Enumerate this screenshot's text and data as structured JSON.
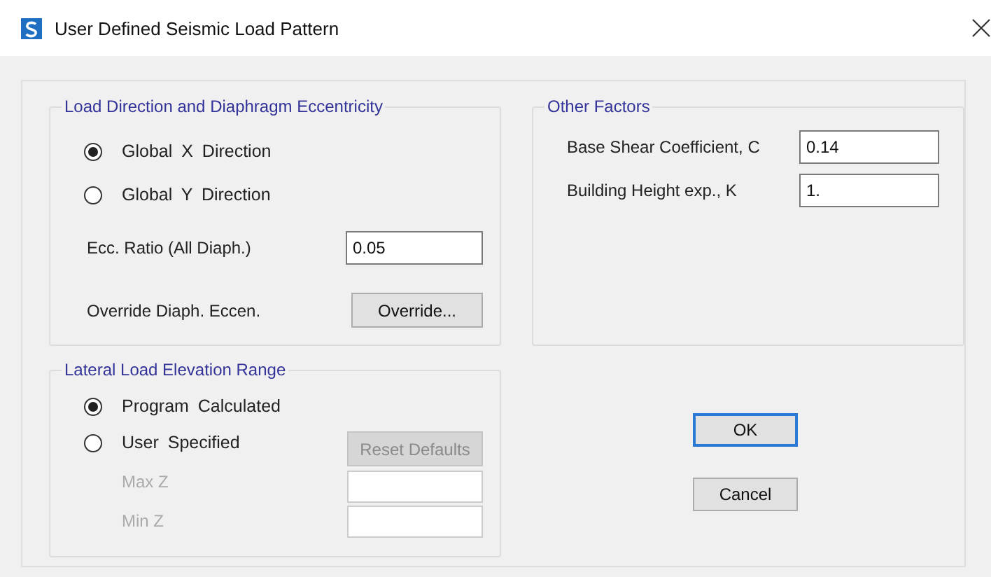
{
  "window": {
    "title": "User Defined Seismic Load Pattern"
  },
  "load_direction": {
    "title": "Load Direction and Diaphragm Eccentricity",
    "options": [
      {
        "label": "Global X Direction",
        "selected": true
      },
      {
        "label": "Global Y Direction",
        "selected": false
      }
    ],
    "ecc_ratio": {
      "label": "Ecc. Ratio (All Diaph.)",
      "value": "0.05"
    },
    "override": {
      "label": "Override Diaph. Eccen.",
      "button": "Override..."
    }
  },
  "other_factors": {
    "title": "Other Factors",
    "fields": [
      {
        "label": "Base Shear Coefficient, C",
        "value": "0.14"
      },
      {
        "label": "Building Height exp., K",
        "value": "1."
      }
    ]
  },
  "elevation_range": {
    "title": "Lateral Load Elevation Range",
    "options": [
      {
        "label": "Program Calculated",
        "selected": true
      },
      {
        "label": "User Specified",
        "selected": false
      }
    ],
    "reset_button": {
      "label": "Reset Defaults",
      "disabled": true
    },
    "fields": [
      {
        "label": "Max Z",
        "disabled": true
      },
      {
        "label": "Min Z",
        "disabled": true
      }
    ]
  },
  "buttons": [
    {
      "label": "OK",
      "default": true
    },
    {
      "label": "Cancel",
      "default": false
    }
  ]
}
